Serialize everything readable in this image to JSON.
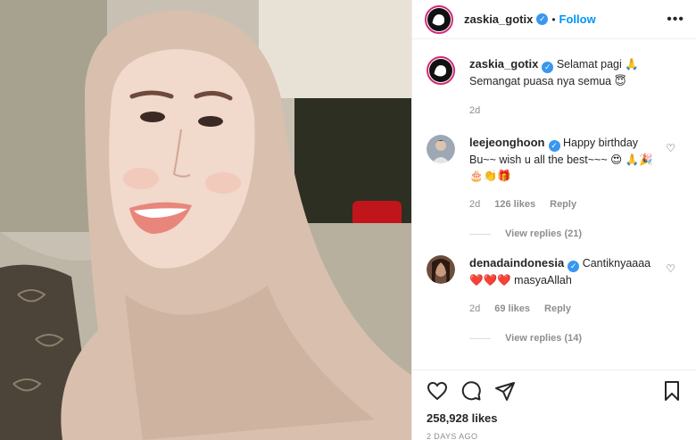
{
  "post": {
    "username": "zaskia_gotix",
    "separator": "•",
    "follow_label": "Follow",
    "more_icon": "more-options-icon",
    "more_glyph": "•••",
    "verified_glyph": "✓"
  },
  "caption": {
    "username": "zaskia_gotix",
    "line1": "Selamat pagi 🙏",
    "line2": "Semangat puasa nya semua 😇",
    "age": "2d"
  },
  "comments": [
    {
      "username": "leejeonghoon",
      "text": "Happy birthday Bu~~ wish u all the best~~~ 😍 🙏🎉🎂👏🎁",
      "age": "2d",
      "likes": "126 likes",
      "reply_label": "Reply",
      "view_replies": "View replies (21)"
    },
    {
      "username": "denadaindonesia",
      "text": "Cantiknyaaaa ❤️❤️❤️ masyaAllah",
      "age": "2d",
      "likes": "69 likes",
      "reply_label": "Reply",
      "view_replies": "View replies (14)"
    }
  ],
  "actions": {
    "likes_count": "258,928 likes",
    "posted_ago": "2 DAYS AGO",
    "icons": [
      "heart-icon",
      "comment-icon",
      "share-icon",
      "bookmark-icon"
    ]
  },
  "colors": {
    "follow": "#0095f6",
    "verified": "#3897f0",
    "muted": "#8e8e8e",
    "text": "#262626"
  }
}
